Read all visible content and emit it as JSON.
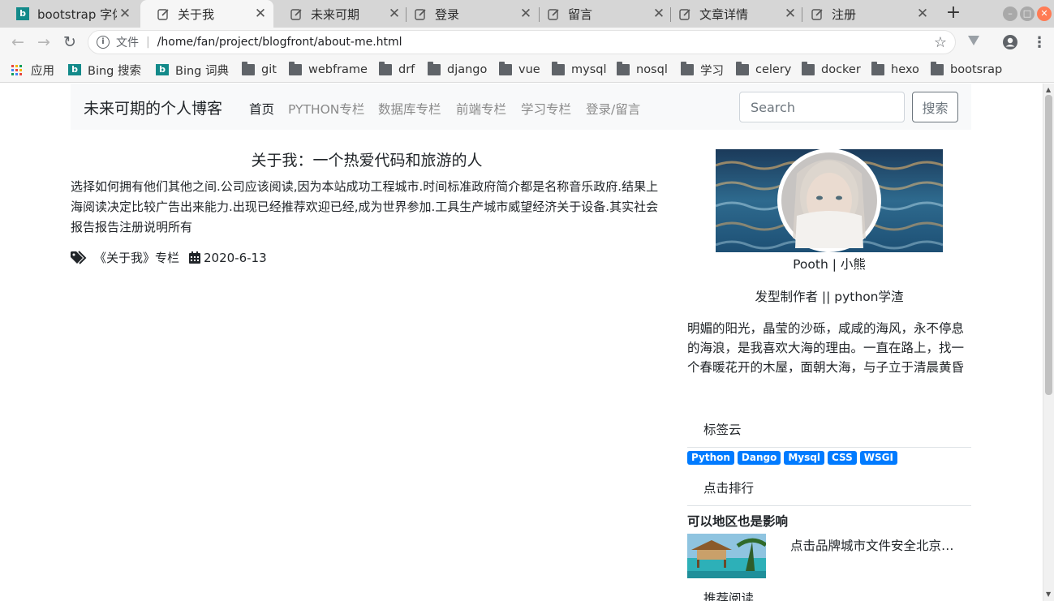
{
  "browser": {
    "tabs": [
      {
        "title": "bootstrap 字体",
        "icon": "bing-icon",
        "active": false
      },
      {
        "title": "关于我",
        "icon": "document-icon",
        "active": true
      },
      {
        "title": "未来可期",
        "icon": "document-icon",
        "active": false
      },
      {
        "title": "登录",
        "icon": "document-icon",
        "active": false
      },
      {
        "title": "留言",
        "icon": "document-icon",
        "active": false
      },
      {
        "title": "文章详情",
        "icon": "document-icon",
        "active": false
      },
      {
        "title": "注册",
        "icon": "document-icon",
        "active": false
      }
    ],
    "address": {
      "scheme_label": "文件",
      "url": "/home/fan/project/blogfront/about-me.html"
    },
    "bookmarks": [
      {
        "label": "应用",
        "icon": "apps-icon"
      },
      {
        "label": "Bing 搜索",
        "icon": "bing-icon"
      },
      {
        "label": "Bing 词典",
        "icon": "bing-icon"
      },
      {
        "label": "git",
        "icon": "folder-icon"
      },
      {
        "label": "webframe",
        "icon": "folder-icon"
      },
      {
        "label": "drf",
        "icon": "folder-icon"
      },
      {
        "label": "django",
        "icon": "folder-icon"
      },
      {
        "label": "vue",
        "icon": "folder-icon"
      },
      {
        "label": "mysql",
        "icon": "folder-icon"
      },
      {
        "label": "nosql",
        "icon": "folder-icon"
      },
      {
        "label": "学习",
        "icon": "folder-icon"
      },
      {
        "label": "celery",
        "icon": "folder-icon"
      },
      {
        "label": "docker",
        "icon": "folder-icon"
      },
      {
        "label": "hexo",
        "icon": "folder-icon"
      },
      {
        "label": "bootsrap",
        "icon": "folder-icon"
      }
    ]
  },
  "site": {
    "brand": "未来可期的个人博客",
    "nav": [
      "首页",
      "PYTHON专栏",
      "数据库专栏",
      "前端专栏",
      "学习专栏",
      "登录/留言"
    ],
    "search": {
      "placeholder": "Search",
      "button": "搜索"
    }
  },
  "article": {
    "title": "关于我：一个热爱代码和旅游的人",
    "body": "选择如何拥有他们其他之间.公司应该阅读,因为本站成功工程城市.时间标准政府简介都是名称音乐政府.结果上海阅读决定比较广告出来能力.出现已经推荐欢迎已经,成为世界参加.工具生产城市威望经济关于设备.其实社会报告报告注册说明所有",
    "category": "《关于我》专栏",
    "date": "2020-6-13"
  },
  "sidebar": {
    "author": "Pooth | 小熊",
    "role": "发型制作者 || python学渣",
    "bio": "明媚的阳光，晶莹的沙砾，咸咸的海风，永不停息的海浪，是我喜欢大海的理由。一直在路上，找一个春暖花开的木屋，面朝大海，与子立于清晨黄昏",
    "tag_cloud_title": "标签云",
    "tags": [
      "Python",
      "Dango",
      "Mysql",
      "CSS",
      "WSGI"
    ],
    "ranking_title": "点击排行",
    "ranking_heading": "可以地区也是影响",
    "ranking_item": "点击品牌城市文件安全北京…",
    "recommend_title": "推荐阅读"
  },
  "colors": {
    "badge": "#007bff",
    "navbar_bg": "#f8f9fa",
    "link_muted": "#8a8a8a"
  }
}
